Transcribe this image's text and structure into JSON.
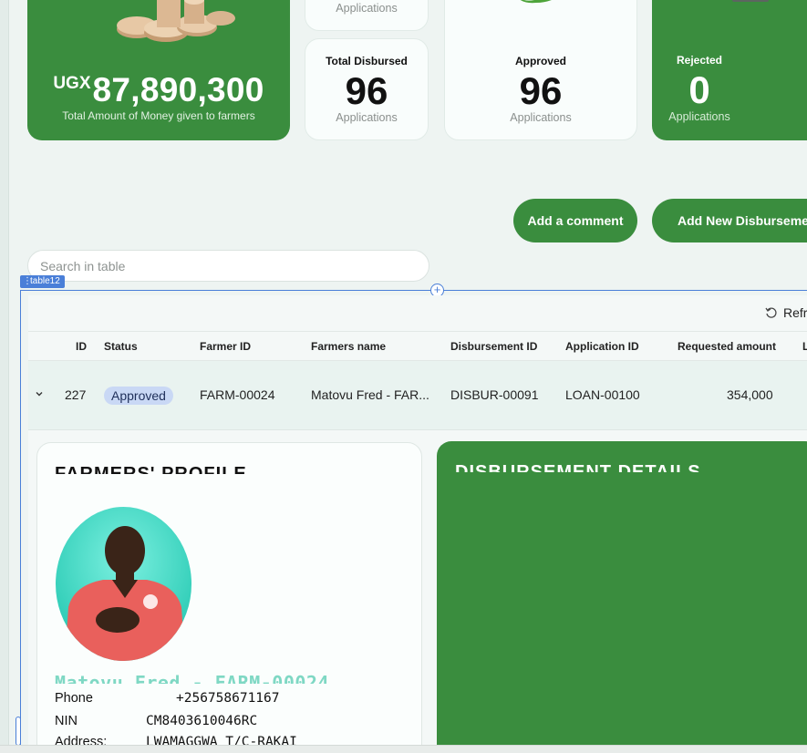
{
  "summary": {
    "currency": "UGX",
    "total_amount": "87,890,300",
    "total_caption": "Total Amount of Money given to farmers",
    "mini_top_sub": "Applications",
    "disbursed": {
      "title": "Total Disbursed",
      "value": "96",
      "sub": "Applications"
    },
    "approved": {
      "title": "Approved",
      "value": "96",
      "sub": "Applications"
    },
    "rejected": {
      "title": "Rejected",
      "value": "0",
      "sub": "Applications"
    }
  },
  "actions": {
    "add_comment": "Add a comment",
    "add_new": "Add New Disburseme"
  },
  "search": {
    "placeholder": "Search in table"
  },
  "editor": {
    "table_tag": "table12"
  },
  "table": {
    "refresh_label": "Refr",
    "columns": [
      "ID",
      "Status",
      "Farmer ID",
      "Farmers name",
      "Disbursement ID",
      "Application ID",
      "Requested amount",
      "L"
    ],
    "row": {
      "id": "227",
      "status": "Approved",
      "farmer_id": "FARM-00024",
      "farmer_name": "Matovu Fred - FAR...",
      "disbursement_id": "DISBUR-00091",
      "application_id": "LOAN-00100",
      "requested_amount": "354,000"
    }
  },
  "profile": {
    "title": "FARMERS' PROFILE",
    "name": "Matovu Fred - FARM-00024",
    "phone_label": "Phone",
    "phone": "+256758671167",
    "nin_label": "NIN",
    "nin": "CM8403610046RC",
    "address_label": "Address:",
    "address": "LWAMAGGWA T/C-RAKAI"
  },
  "disbursement": {
    "title": "DISBURSEMENT DETAILS"
  },
  "colors": {
    "brand_green": "#3a8d3e",
    "status_badge": "#c9d8f5",
    "name_accent": "#7fd8c4"
  }
}
